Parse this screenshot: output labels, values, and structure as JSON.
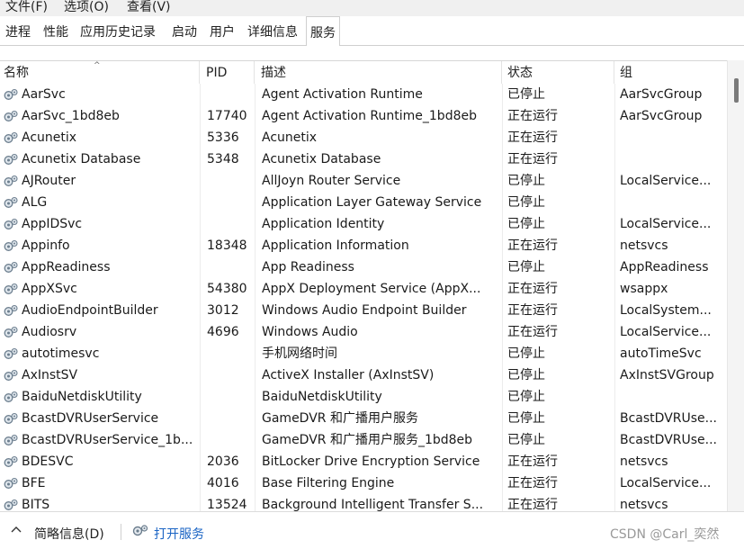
{
  "menubar": {
    "items": [
      "文件(F)",
      "选项(O)",
      "查看(V)"
    ]
  },
  "tabs": [
    "进程",
    "性能",
    "应用历史记录",
    "启动",
    "用户",
    "详细信息",
    "服务"
  ],
  "columns": {
    "name": "名称",
    "pid": "PID",
    "desc": "描述",
    "status": "状态",
    "group": "组"
  },
  "sort_indicator": "^",
  "services": [
    {
      "name": "AarSvc",
      "pid": "",
      "desc": "Agent Activation Runtime",
      "status": "已停止",
      "group": "AarSvcGroup"
    },
    {
      "name": "AarSvc_1bd8eb",
      "pid": "17740",
      "desc": "Agent Activation Runtime_1bd8eb",
      "status": "正在运行",
      "group": "AarSvcGroup"
    },
    {
      "name": "Acunetix",
      "pid": "5336",
      "desc": "Acunetix",
      "status": "正在运行",
      "group": ""
    },
    {
      "name": "Acunetix Database",
      "pid": "5348",
      "desc": "Acunetix Database",
      "status": "正在运行",
      "group": ""
    },
    {
      "name": "AJRouter",
      "pid": "",
      "desc": "AllJoyn Router Service",
      "status": "已停止",
      "group": "LocalService..."
    },
    {
      "name": "ALG",
      "pid": "",
      "desc": "Application Layer Gateway Service",
      "status": "已停止",
      "group": ""
    },
    {
      "name": "AppIDSvc",
      "pid": "",
      "desc": "Application Identity",
      "status": "已停止",
      "group": "LocalService..."
    },
    {
      "name": "Appinfo",
      "pid": "18348",
      "desc": "Application Information",
      "status": "正在运行",
      "group": "netsvcs"
    },
    {
      "name": "AppReadiness",
      "pid": "",
      "desc": "App Readiness",
      "status": "已停止",
      "group": "AppReadiness"
    },
    {
      "name": "AppXSvc",
      "pid": "54380",
      "desc": "AppX Deployment Service (AppX...",
      "status": "正在运行",
      "group": "wsappx"
    },
    {
      "name": "AudioEndpointBuilder",
      "pid": "3012",
      "desc": "Windows Audio Endpoint Builder",
      "status": "正在运行",
      "group": "LocalSystem..."
    },
    {
      "name": "Audiosrv",
      "pid": "4696",
      "desc": "Windows Audio",
      "status": "正在运行",
      "group": "LocalService..."
    },
    {
      "name": "autotimesvc",
      "pid": "",
      "desc": "手机网络时间",
      "status": "已停止",
      "group": "autoTimeSvc"
    },
    {
      "name": "AxInstSV",
      "pid": "",
      "desc": "ActiveX Installer (AxInstSV)",
      "status": "已停止",
      "group": "AxInstSVGroup"
    },
    {
      "name": "BaiduNetdiskUtility",
      "pid": "",
      "desc": "BaiduNetdiskUtility",
      "status": "已停止",
      "group": ""
    },
    {
      "name": "BcastDVRUserService",
      "pid": "",
      "desc": "GameDVR 和广播用户服务",
      "status": "已停止",
      "group": "BcastDVRUse..."
    },
    {
      "name": "BcastDVRUserService_1b...",
      "pid": "",
      "desc": "GameDVR 和广播用户服务_1bd8eb",
      "status": "已停止",
      "group": "BcastDVRUse..."
    },
    {
      "name": "BDESVC",
      "pid": "2036",
      "desc": "BitLocker Drive Encryption Service",
      "status": "正在运行",
      "group": "netsvcs"
    },
    {
      "name": "BFE",
      "pid": "4016",
      "desc": "Base Filtering Engine",
      "status": "正在运行",
      "group": "LocalService..."
    },
    {
      "name": "BITS",
      "pid": "13524",
      "desc": "Background Intelligent Transfer S...",
      "status": "正在运行",
      "group": "netsvcs"
    }
  ],
  "footer": {
    "fewer_details": "简略信息(D)",
    "open_services": "打开服务",
    "watermark": "CSDN @Carl_奕然"
  },
  "colors": {
    "link": "#1a64c4",
    "header_border": "#d6d6d6",
    "scroll_thumb": "#7a7a7a"
  },
  "icons": {
    "row": "service-gear-icon",
    "fewer": "chevron-up-icon",
    "open": "services-gear-icon"
  }
}
